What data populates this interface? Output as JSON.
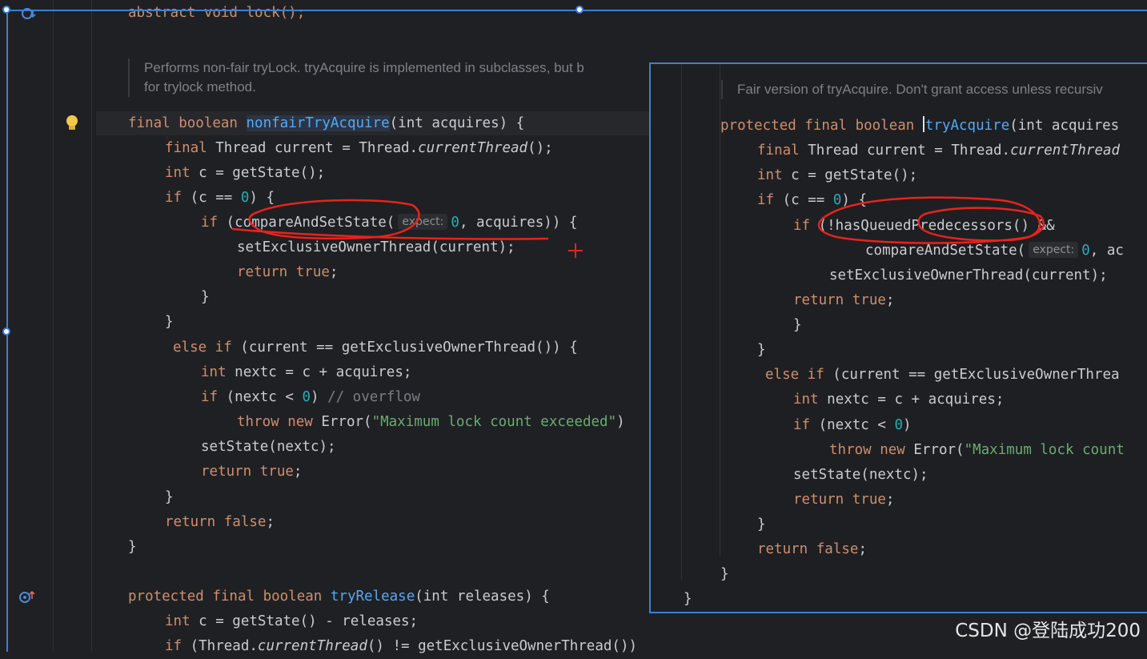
{
  "left_editor": {
    "lines": {
      "l01": "abstract void lock();",
      "doc1": "Performs non-fair tryLock. tryAcquire is implemented in subclasses, but b",
      "doc2": "for trylock method.",
      "m1_sig_kw": "final boolean ",
      "m1_sig_name": "nonfairTryAcquire",
      "m1_sig_rest": "(int acquires) {",
      "m1_l1_kw": "final ",
      "m1_l1_a": "Thread current = Thread.",
      "m1_l1_it": "currentThread",
      "m1_l1_b": "();",
      "m1_l2_kw": "int ",
      "m1_l2_rest": "c = getState();",
      "m1_l3_kw": "if ",
      "m1_l3_a": "(c == ",
      "m1_l3_num": "0",
      "m1_l3_b": ") {",
      "m1_l4_kw": "if ",
      "m1_l4_a": "(compareAndSetState(",
      "m1_l4_hint": "expect:",
      "m1_l4_num": "0",
      "m1_l4_b": ", acquires)) {",
      "m1_l5": "setExclusiveOwnerThread(current);",
      "m1_l6_kw": "return true",
      "m1_l6_b": ";",
      "m1_l7": "}",
      "m1_l8": "}",
      "m1_l9_kw": "else if ",
      "m1_l9_rest": "(current == getExclusiveOwnerThread()) {",
      "m1_l10_kw": "int ",
      "m1_l10_rest": "nextc = c + acquires;",
      "m1_l11_kw": "if ",
      "m1_l11_a": "(nextc < ",
      "m1_l11_num": "0",
      "m1_l11_b": ") ",
      "m1_l11_cm": "// overflow",
      "m1_l12_kw": "throw new ",
      "m1_l12_a": "Error(",
      "m1_l12_str": "\"Maximum lock count exceeded\"",
      "m1_l12_b": ")",
      "m1_l13": "setState(nextc);",
      "m1_l14_kw": "return true",
      "m1_l14_b": ";",
      "m1_l15": "}",
      "m1_l16_kw": "return false",
      "m1_l16_b": ";",
      "m1_l17": "}",
      "m2_sig_kw": "protected final boolean ",
      "m2_sig_name": "tryRelease",
      "m2_sig_rest": "(int releases) {",
      "m2_l1_kw": "int ",
      "m2_l1_rest": "c = getState() - releases;",
      "m2_l2_kw": "if ",
      "m2_l2_a": "(Thread.",
      "m2_l2_it": "currentThread",
      "m2_l2_b": "() != getExclusiveOwnerThread())"
    }
  },
  "right_editor": {
    "lines": {
      "doc": "Fair version of tryAcquire. Don't grant access unless recursiv",
      "sig_kw": "protected final boolean ",
      "sig_name": "tryAcquire",
      "sig_rest": "(int acquires",
      "l1_kw": "final ",
      "l1_a": "Thread current = Thread.",
      "l1_it": "currentThread",
      "l2_kw": "int ",
      "l2_rest": "c = getState();",
      "l3_kw": "if ",
      "l3_a": "(c == ",
      "l3_num": "0",
      "l3_b": ") {",
      "l4_kw": "if ",
      "l4_a": "(!hasQueuedPredecessors() &&",
      "l5_a": "compareAndSetState(",
      "l5_hint": "expect:",
      "l5_num": "0",
      "l5_b": ", ac",
      "l6": "setExclusiveOwnerThread(current);",
      "l7_kw": "return true",
      "l7_b": ";",
      "l8": "}",
      "l9": "}",
      "l10_kw": "else if ",
      "l10_rest": "(current == getExclusiveOwnerThrea",
      "l11_kw": "int ",
      "l11_rest": "nextc = c + acquires;",
      "l12_kw": "if ",
      "l12_a": "(nextc < ",
      "l12_num": "0",
      "l12_b": ")",
      "l13_kw": "throw new ",
      "l13_a": "Error(",
      "l13_str": "\"Maximum lock count",
      "l14": "setState(nextc);",
      "l15_kw": "return true",
      "l15_b": ";",
      "l16": "}",
      "l17_kw": "return false",
      "l17_b": ";",
      "l18": "}",
      "l19": "}"
    }
  },
  "gutter_icons": {
    "top": "override-down-icon",
    "bulb": "lightbulb-icon",
    "bottom": "override-up-icon"
  },
  "watermark": "CSDN @登陆成功200",
  "colors": {
    "selection": "#3d7fd6",
    "annotation": "#e8231d",
    "background": "#1f2023"
  }
}
